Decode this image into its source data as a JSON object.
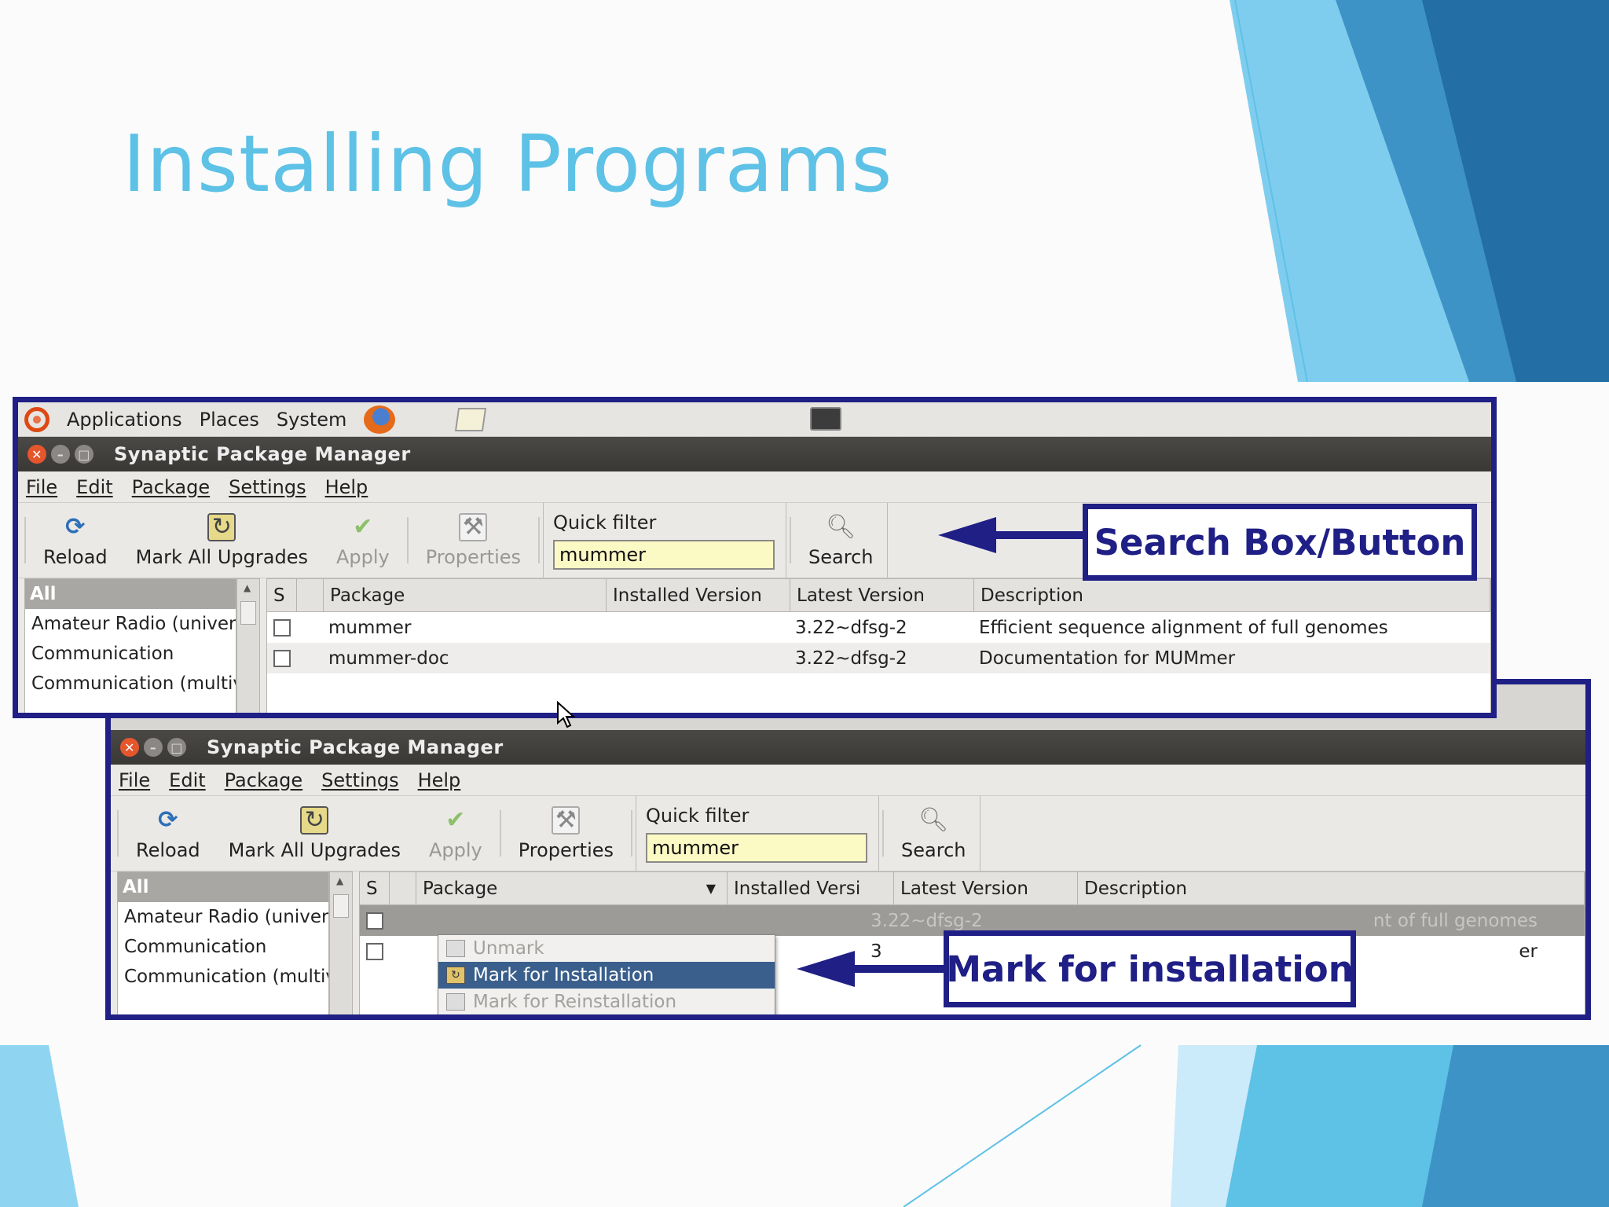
{
  "slide": {
    "title": "Installing Programs"
  },
  "colors": {
    "title": "#5ec1e6",
    "frame": "#1f1f86",
    "accent_blue_dark": "#1f6ca3",
    "accent_blue_light": "#5ec1e6"
  },
  "top_panel": {
    "applications": "Applications",
    "places": "Places",
    "system": "System"
  },
  "window1": {
    "title": "Synaptic Package Manager",
    "menu": [
      "File",
      "Edit",
      "Package",
      "Settings",
      "Help"
    ],
    "toolbar": {
      "reload": "Reload",
      "mark_all": "Mark All Upgrades",
      "apply": "Apply",
      "properties": "Properties",
      "quick_filter_label": "Quick filter",
      "quick_filter_value": "mummer",
      "search": "Search"
    },
    "sections": [
      "All",
      "Amateur Radio (universe)",
      "Communication",
      "Communication (multivers"
    ],
    "columns": [
      "S",
      "",
      "Package",
      "Installed Version",
      "Latest Version",
      "Description"
    ],
    "rows": [
      {
        "package": "mummer",
        "installed": "",
        "latest": "3.22~dfsg-2",
        "description": "Efficient sequence alignment of full genomes"
      },
      {
        "package": "mummer-doc",
        "installed": "",
        "latest": "3.22~dfsg-2",
        "description": "Documentation for MUMmer"
      }
    ]
  },
  "window2": {
    "title": "Synaptic Package Manager",
    "menu": [
      "File",
      "Edit",
      "Package",
      "Settings",
      "Help"
    ],
    "toolbar": {
      "reload": "Reload",
      "mark_all": "Mark All Upgrades",
      "apply": "Apply",
      "properties": "Properties",
      "quick_filter_label": "Quick filter",
      "quick_filter_value": "mummer",
      "search": "Search"
    },
    "sections": [
      "All",
      "Amateur Radio (universe)",
      "Communication",
      "Communication (multivers"
    ],
    "columns": [
      "S",
      "",
      "Package",
      "Installed Versi",
      "Latest Version",
      "Description"
    ],
    "rows": [
      {
        "latest_partial": "3.22~dfsg-2",
        "description_partial": "nt of full genomes"
      },
      {
        "latest_partial": "3",
        "description_partial": "er"
      }
    ],
    "context_menu": [
      "Unmark",
      "Mark for Installation",
      "Mark for Reinstallation"
    ]
  },
  "callouts": {
    "search": "Search Box/Button",
    "mark": "Mark for installation"
  }
}
